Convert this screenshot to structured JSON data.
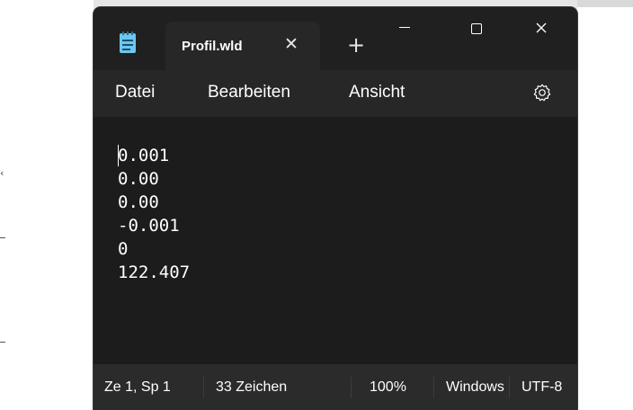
{
  "background": {
    "mark": "‹"
  },
  "window": {
    "tab": {
      "title": "Profil.wld",
      "close_glyph": "✕"
    },
    "new_tab_glyph": "+",
    "controls": {
      "minimize_icon": "minimize-icon",
      "maximize_icon": "maximize-icon",
      "close_glyph": "✕"
    }
  },
  "menu": {
    "items": [
      "Datei",
      "Bearbeiten",
      "Ansicht"
    ],
    "settings_icon": "gear-icon"
  },
  "editor": {
    "lines": [
      "0.001",
      "0.00",
      "0.00",
      "-0.001",
      "0",
      "122.407"
    ]
  },
  "status": {
    "position": "Ze 1, Sp 1",
    "chars": "33 Zeichen",
    "zoom": "100%",
    "line_ending": "Windows (CRLF)",
    "encoding": "UTF-8"
  },
  "colors": {
    "window_bg": "#202020",
    "editor_bg": "#1c1c1c",
    "app_icon_accent": "#6cc7f0"
  }
}
